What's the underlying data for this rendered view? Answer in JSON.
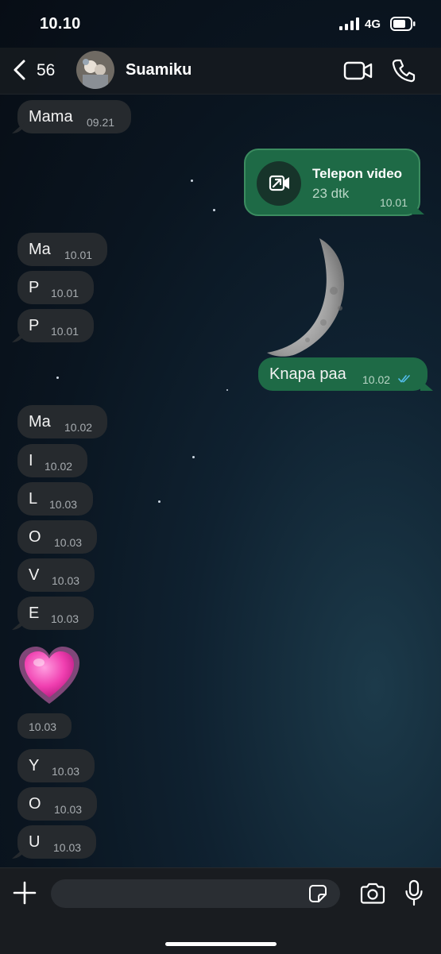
{
  "status": {
    "time": "10.10",
    "network": "4G"
  },
  "header": {
    "unread_count": "56",
    "contact_name": "Suamiku"
  },
  "call": {
    "title": "Telepon video",
    "duration": "23 dtk",
    "time": "10.01"
  },
  "messages": [
    {
      "text": "Mama",
      "time": "09.21",
      "dir": "in"
    },
    {
      "text": "Ma",
      "time": "10.01",
      "dir": "in"
    },
    {
      "text": "P",
      "time": "10.01",
      "dir": "in"
    },
    {
      "text": "P",
      "time": "10.01",
      "dir": "in"
    },
    {
      "text": "Knapa paa",
      "time": "10.02",
      "dir": "out",
      "read": true
    },
    {
      "text": "Ma",
      "time": "10.02",
      "dir": "in"
    },
    {
      "text": "I",
      "time": "10.02",
      "dir": "in"
    },
    {
      "text": "L",
      "time": "10.03",
      "dir": "in"
    },
    {
      "text": "O",
      "time": "10.03",
      "dir": "in"
    },
    {
      "text": "V",
      "time": "10.03",
      "dir": "in"
    },
    {
      "text": "E",
      "time": "10.03",
      "dir": "in"
    },
    {
      "text": "💗",
      "time": "10.03",
      "dir": "in",
      "emoji": "growing-heart"
    },
    {
      "text": "Y",
      "time": "10.03",
      "dir": "in"
    },
    {
      "text": "O",
      "time": "10.03",
      "dir": "in"
    },
    {
      "text": "U",
      "time": "10.03",
      "dir": "in"
    }
  ],
  "input": {
    "placeholder": "",
    "value": ""
  },
  "icons": {
    "back": "chevron-left-icon",
    "video_call": "video-camera-icon",
    "voice_call": "phone-icon",
    "add": "plus-icon",
    "sticker": "sticker-icon",
    "camera": "camera-icon",
    "mic": "microphone-icon",
    "call_card": "outgoing-video-call-icon",
    "read_receipt": "double-check-icon"
  },
  "colors": {
    "incoming_bubble": "#262a2e",
    "outgoing_bubble": "#1e6a46",
    "read_tick": "#53bdeb",
    "background": "#0a1520"
  }
}
